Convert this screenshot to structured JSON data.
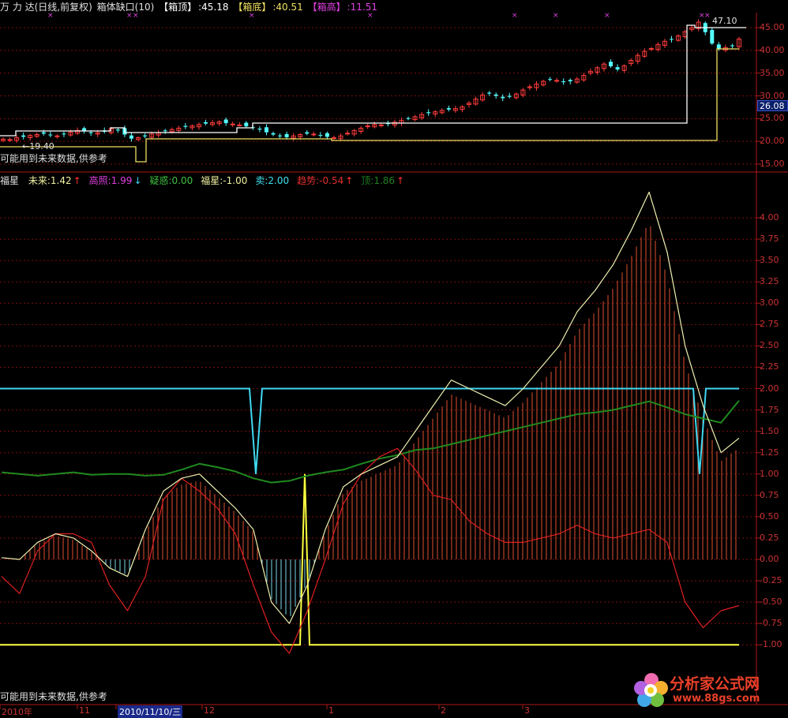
{
  "top_header": {
    "app": "万 力 达(日线,前复权)",
    "indicator": "箱体缺口(10)",
    "box_top_label": "【箱顶】",
    "box_top_value": ":45.18",
    "box_bottom_label": "【箱底】",
    "box_bottom_value": ":40.51",
    "box_height_label": "【箱高】",
    "box_height_value": ":11.51"
  },
  "top_panel": {
    "low_marker": "←19.40",
    "high_marker": "47.10",
    "future_note": "可能用到未来数据,供参考",
    "current_price": "26.08",
    "y_labels": [
      "45.00",
      "40.00",
      "35.00",
      "30.00",
      "25.00",
      "20.00",
      "15.00"
    ]
  },
  "bottom_header": {
    "name": "福星",
    "items": [
      {
        "label": "未来:1.42",
        "arrow": "↑",
        "color": "#f0f0a0"
      },
      {
        "label": "高照:1.99",
        "arrow": "↓",
        "color": "#e040e0"
      },
      {
        "label": "疑惑:0.00",
        "arrow": "",
        "color": "#40c040"
      },
      {
        "label": "福星:-1.00",
        "arrow": "",
        "color": "#f0f0a0"
      },
      {
        "label": "卖:2.00",
        "arrow": "",
        "color": "#40e0f0"
      },
      {
        "label": "趋势:-0.54",
        "arrow": "↑",
        "color": "#e03030"
      },
      {
        "label": "顶:1.86",
        "arrow": "↑",
        "color": "#208020"
      }
    ]
  },
  "bottom_panel": {
    "future_note": "可能用到未来数据,供参考",
    "y_labels": [
      "4.00",
      "3.75",
      "3.50",
      "3.25",
      "3.00",
      "2.75",
      "2.50",
      "2.25",
      "2.00",
      "1.75",
      "1.50",
      "1.25",
      "1.00",
      "0.75",
      "0.50",
      "0.25",
      "0.00",
      "-0.25",
      "-0.50",
      "-0.75",
      "-1.00"
    ]
  },
  "date_axis": {
    "labels": [
      {
        "text": "2010年",
        "highlight": false
      },
      {
        "text": "11",
        "highlight": false
      },
      {
        "text": "2010/11/10/三",
        "highlight": true
      },
      {
        "text": "12",
        "highlight": false
      },
      {
        "text": "1",
        "highlight": false
      },
      {
        "text": "2",
        "highlight": false
      },
      {
        "text": "3",
        "highlight": false
      }
    ]
  },
  "watermark": {
    "name": "分析家公式网",
    "url": "www.88gs.com"
  },
  "colors": {
    "grid": "#7a1010",
    "axis": "#b01818",
    "up": "#ff3c3c",
    "down": "#54ffff",
    "box_white": "#ffffff",
    "box_yellow": "#f0e060",
    "cyan": "#40d8f0",
    "green": "#1f8a1f",
    "yellow": "#ffff40",
    "pale": "#f0f0b0",
    "red": "#e02020"
  },
  "chart_data": [
    {
      "type": "candlestick",
      "title": "万 力 达(日线,前复权)",
      "ylim": [
        15,
        47
      ],
      "close_series_approx": [
        20.5,
        20.4,
        20.8,
        21,
        21.3,
        21.5,
        21.7,
        21.4,
        21.2,
        21.6,
        22,
        22.4,
        22.2,
        21.8,
        21.9,
        22.1,
        22.8,
        22.4,
        21.5,
        20.6,
        20.8,
        21.1,
        21.6,
        21.9,
        22.3,
        22.6,
        22.9,
        23.2,
        23.4,
        23.7,
        23.9,
        24.1,
        24.3,
        24.0,
        23.8,
        23.6,
        23.3,
        23.0,
        22.6,
        22.0,
        21.5,
        21.1,
        20.9,
        21.2,
        21.5,
        21.7,
        21.6,
        21.3,
        21.0,
        20.8,
        21.2,
        21.8,
        22.4,
        22.9,
        23.4,
        23.7,
        23.6,
        23.8,
        24.2,
        24.6,
        25.0,
        25.4,
        25.9,
        26.2,
        26.5,
        26.8,
        27.0,
        27.2,
        27.6,
        28.4,
        29.3,
        30.2,
        30.5,
        30.0,
        29.5,
        29.8,
        30.4,
        31.3,
        32.0,
        32.6,
        33.2,
        33.6,
        33.4,
        33.0,
        33.2,
        33.7,
        34.5,
        35.4,
        36.2,
        37.0,
        36.5,
        35.8,
        36.6,
        37.8,
        38.9,
        39.8,
        40.4,
        41.3,
        42.0,
        42.4,
        43.2,
        44.1,
        45.0,
        46.2,
        44.0,
        41.5,
        40.3,
        40.6,
        41.0,
        42.5
      ]
    },
    {
      "type": "line",
      "title": "福星",
      "ylim": [
        -1.25,
        4.25
      ],
      "series": [
        {
          "name": "未来",
          "values": [
            0.02,
            0.0,
            0.2,
            0.3,
            0.25,
            0.1,
            -0.1,
            -0.2,
            0.35,
            0.8,
            0.95,
            1.0,
            0.8,
            0.6,
            0.35,
            -0.5,
            -0.75,
            -0.3,
            0.35,
            0.85,
            1.0,
            1.1,
            1.2,
            1.5,
            1.8,
            2.1,
            2.0,
            1.9,
            1.8,
            2.0,
            2.25,
            2.5,
            2.9,
            3.15,
            3.45,
            3.85,
            4.3,
            3.6,
            2.5,
            1.8,
            1.25,
            1.42
          ]
        },
        {
          "name": "福星",
          "values": [
            -1.0,
            -1.0,
            -1.0,
            -1.0,
            -1.0,
            -1.0,
            -1.0,
            -1.0,
            -1.0,
            -1.0,
            -1.0,
            -1.0,
            -1.0,
            -1.0,
            -1.0,
            -1.0,
            -1.0,
            -1.0,
            -1.0,
            -1.0,
            -1.0,
            -1.0,
            -1.0,
            -1.0,
            -1.0,
            -1.0,
            -1.0,
            -1.0,
            -1.0,
            -1.0,
            -1.0,
            -1.0,
            -1.0,
            -1.0,
            -1.0,
            -1.0,
            -1.0,
            -1.0,
            -1.0,
            -1.0,
            -1.0,
            -1.0
          ]
        },
        {
          "name": "卖",
          "values": [
            2.0,
            2.0,
            2.0,
            2.0,
            2.0,
            2.0,
            2.0,
            2.0,
            2.0,
            2.0,
            2.0,
            2.0,
            2.0,
            2.0,
            2.0,
            2.0,
            2.0,
            2.0,
            2.0,
            2.0,
            2.0,
            2.0,
            2.0,
            2.0,
            2.0,
            2.0,
            2.0,
            2.0,
            2.0,
            2.0,
            2.0,
            2.0,
            2.0,
            2.0,
            2.0,
            2.0,
            2.0,
            2.0,
            2.0,
            2.0,
            2.0,
            2.0
          ]
        },
        {
          "name": "趋势",
          "values": [
            -0.2,
            -0.4,
            0.1,
            0.3,
            0.3,
            0.2,
            -0.3,
            -0.6,
            -0.2,
            0.7,
            0.95,
            0.8,
            0.6,
            0.3,
            -0.3,
            -0.85,
            -1.1,
            -0.6,
            0.0,
            0.65,
            1.0,
            1.2,
            1.3,
            1.05,
            0.75,
            0.7,
            0.45,
            0.3,
            0.2,
            0.2,
            0.25,
            0.3,
            0.4,
            0.3,
            0.25,
            0.3,
            0.35,
            0.2,
            -0.5,
            -0.8,
            -0.6,
            -0.54
          ]
        },
        {
          "name": "顶",
          "values": [
            1.02,
            1.0,
            0.98,
            1.0,
            1.02,
            0.99,
            1.0,
            1.0,
            0.98,
            0.99,
            1.05,
            1.12,
            1.08,
            1.03,
            0.95,
            0.9,
            0.92,
            0.98,
            1.02,
            1.05,
            1.12,
            1.18,
            1.22,
            1.28,
            1.3,
            1.35,
            1.4,
            1.45,
            1.5,
            1.55,
            1.6,
            1.65,
            1.7,
            1.72,
            1.75,
            1.8,
            1.85,
            1.78,
            1.7,
            1.65,
            1.6,
            1.86
          ]
        }
      ]
    }
  ]
}
